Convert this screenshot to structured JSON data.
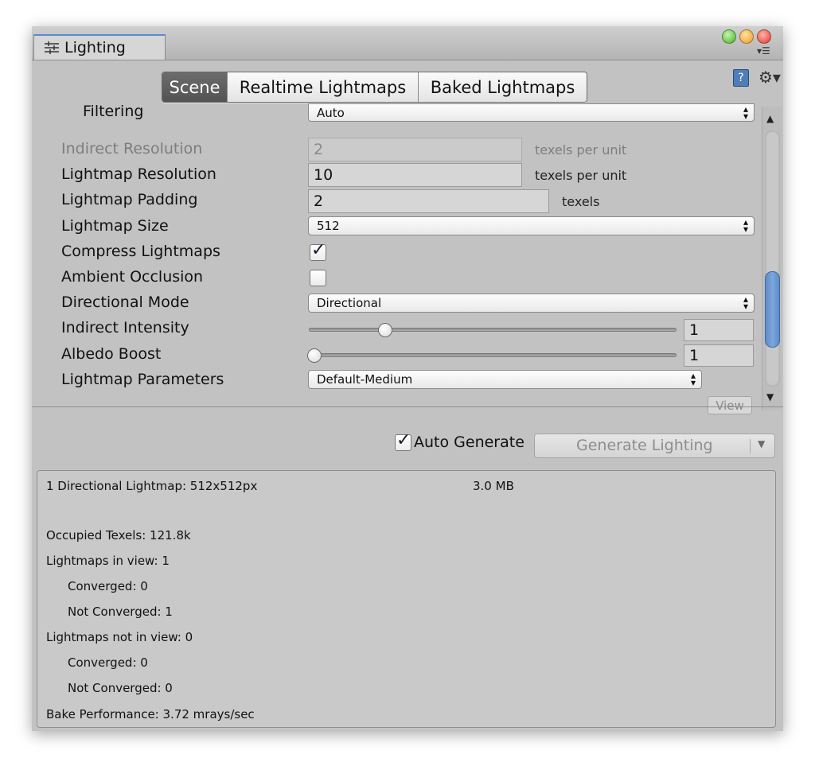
{
  "window": {
    "title": "Lighting"
  },
  "tabs": [
    "Scene",
    "Realtime Lightmaps",
    "Baked Lightmaps"
  ],
  "fields": {
    "filtering": {
      "label": "Filtering",
      "value": "Auto"
    },
    "indirect_resolution": {
      "label": "Indirect Resolution",
      "value": "2",
      "unit": "texels per unit"
    },
    "lightmap_resolution": {
      "label": "Lightmap Resolution",
      "value": "10",
      "unit": "texels per unit"
    },
    "lightmap_padding": {
      "label": "Lightmap Padding",
      "value": "2",
      "unit": "texels"
    },
    "lightmap_size": {
      "label": "Lightmap Size",
      "value": "512"
    },
    "compress_lightmaps": {
      "label": "Compress Lightmaps",
      "checked": true
    },
    "ambient_occlusion": {
      "label": "Ambient Occlusion",
      "checked": false
    },
    "directional_mode": {
      "label": "Directional Mode",
      "value": "Directional"
    },
    "indirect_intensity": {
      "label": "Indirect Intensity",
      "value": "1"
    },
    "albedo_boost": {
      "label": "Albedo Boost",
      "value": "1"
    },
    "lightmap_parameters": {
      "label": "Lightmap Parameters",
      "value": "Default-Medium",
      "view_label": "View"
    }
  },
  "footer": {
    "auto_generate_label": "Auto Generate",
    "auto_generate_checked": true,
    "generate_button": "Generate Lighting"
  },
  "stats": {
    "lightmap_summary": "1 Directional Lightmap: 512x512px",
    "lightmap_size": "3.0 MB",
    "occupied_texels": "Occupied Texels: 121.8k",
    "in_view": "Lightmaps in view: 1",
    "in_view_converged": "Converged: 0",
    "in_view_not_converged": "Not Converged: 1",
    "not_in_view": "Lightmaps not in view: 0",
    "not_in_view_converged": "Converged: 0",
    "not_in_view_not_converged": "Not Converged: 0",
    "bake_performance": "Bake Performance: 3.72 mrays/sec"
  }
}
